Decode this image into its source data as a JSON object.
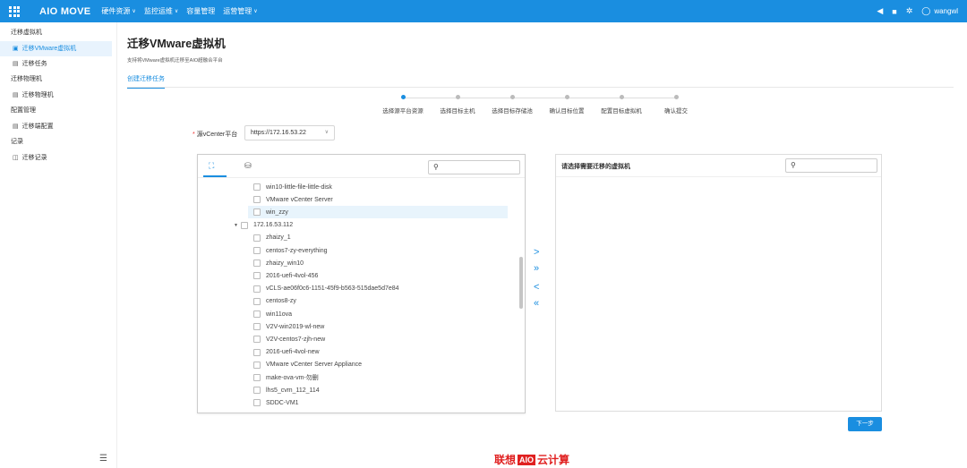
{
  "app": {
    "logo_bold": "AIO",
    "logo_rest": "MOVE",
    "nav": [
      "硬件资源",
      "监控运维",
      "容量管理",
      "运营管理"
    ],
    "nav_has_chevron": [
      true,
      true,
      false,
      true
    ],
    "user": "wangwl"
  },
  "sidebar": {
    "groups": [
      {
        "title": "迁移虚拟机",
        "items": [
          {
            "label": "迁移VMware虚拟机",
            "icon": "vm-icon",
            "active": true
          },
          {
            "label": "迁移任务",
            "icon": "task-icon",
            "active": false
          }
        ]
      },
      {
        "title": "迁移物理机",
        "items": [
          {
            "label": "迁移物理机",
            "icon": "doc-icon",
            "active": false
          }
        ]
      },
      {
        "title": "配置管理",
        "items": [
          {
            "label": "迁移端配置",
            "icon": "doc-icon",
            "active": false
          }
        ]
      },
      {
        "title": "记录",
        "items": [
          {
            "label": "迁移记录",
            "icon": "record-icon",
            "active": false
          }
        ]
      }
    ]
  },
  "page": {
    "title": "迁移VMware虚拟机",
    "subtitle": "支持将VMware虚拟机迁移至AIO超融合平台",
    "tab": "创建迁移任务"
  },
  "steps": [
    {
      "label": "选择源平台资源",
      "active": true
    },
    {
      "label": "选择目标主机",
      "active": false
    },
    {
      "label": "选择目标存储池",
      "active": false
    },
    {
      "label": "确认目标位置",
      "active": false
    },
    {
      "label": "配置目标虚拟机",
      "active": false
    },
    {
      "label": "确认提交",
      "active": false
    }
  ],
  "source": {
    "label": "源vCenter平台",
    "value": "https://172.16.53.22"
  },
  "tree_rows": [
    {
      "label": "win10-little-file-little-disk",
      "level": 2
    },
    {
      "label": "VMware vCenter Server",
      "level": 2
    },
    {
      "label": "win_zzy",
      "level": 2,
      "highlight": true
    },
    {
      "label": "172.16.53.112",
      "level": 1,
      "expanded": true
    },
    {
      "label": "zhaizy_1",
      "level": 2
    },
    {
      "label": "centos7-zy-everything",
      "level": 2
    },
    {
      "label": "zhaizy_win10",
      "level": 2
    },
    {
      "label": "2016-uefi-4vol-456",
      "level": 2
    },
    {
      "label": "vCLS-ae06f0c6-1151-45f9-b563-515dae5d7e84",
      "level": 2
    },
    {
      "label": "centos8-zy",
      "level": 2
    },
    {
      "label": "win11ova",
      "level": 2
    },
    {
      "label": "V2V-win2019-wl-new",
      "level": 2
    },
    {
      "label": "V2V-centos7-zjh-new",
      "level": 2
    },
    {
      "label": "2016-uefi-4vol-new",
      "level": 2
    },
    {
      "label": "VMware vCenter Server Appliance",
      "level": 2
    },
    {
      "label": "make-ova-vm-勿删",
      "level": 2
    },
    {
      "label": "lhs5_cvm_112_114",
      "level": 2
    },
    {
      "label": "SDDC-VM1",
      "level": 2
    }
  ],
  "right_panel": {
    "title": "请选择需要迁移的虚拟机"
  },
  "transfer": {
    "move_right": ">",
    "move_all_right": "»",
    "move_left": "<",
    "move_all_left": "«"
  },
  "buttons": {
    "next": "下一步"
  },
  "footer": {
    "brand_left": "联想",
    "brand_box": "AIO",
    "brand_right": "云计算"
  },
  "colors": {
    "primary": "#1a8ee0",
    "brand_red": "#e02020"
  }
}
